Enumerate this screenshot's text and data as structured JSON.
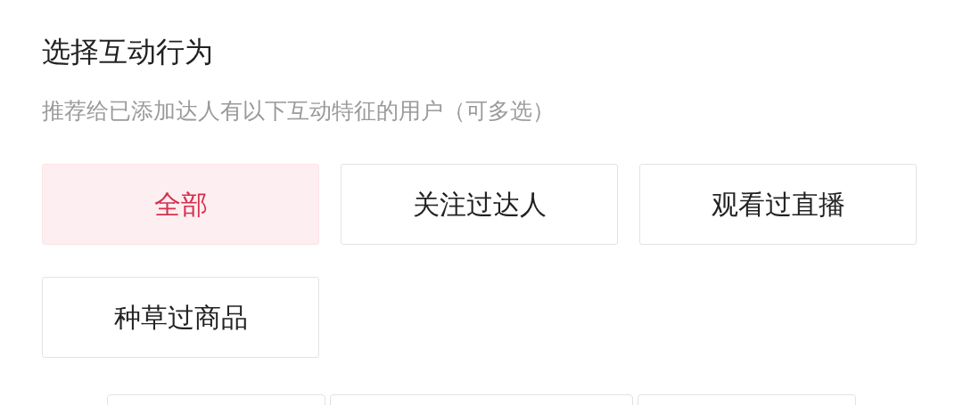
{
  "title": "选择互动行为",
  "subtitle": "推荐给已添加达人有以下互动特征的用户（可多选）",
  "options": [
    {
      "label": "全部",
      "selected": true
    },
    {
      "label": "关注过达人",
      "selected": false
    },
    {
      "label": "观看过直播",
      "selected": false
    },
    {
      "label": "种草过商品",
      "selected": false
    }
  ]
}
